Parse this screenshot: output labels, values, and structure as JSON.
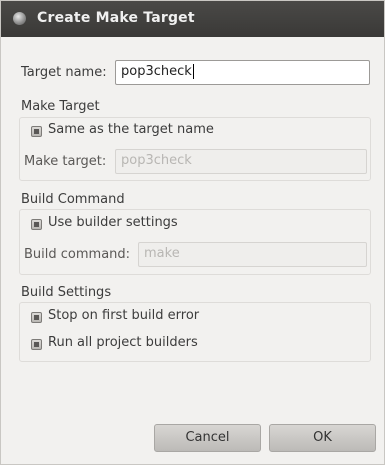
{
  "dialog": {
    "title": "Create Make Target"
  },
  "target": {
    "name_label": "Target name:",
    "name_value": "pop3check"
  },
  "make_target": {
    "section_label": "Make Target",
    "same_as_label": "Same as the target name",
    "same_as_checked": true,
    "field_label": "Make target:",
    "field_value": "pop3check"
  },
  "build_command": {
    "section_label": "Build Command",
    "use_builder_label": "Use builder settings",
    "use_builder_checked": true,
    "field_label": "Build command:",
    "field_value": "make"
  },
  "build_settings": {
    "section_label": "Build Settings",
    "stop_on_error_label": "Stop on first build error",
    "stop_on_error_checked": true,
    "run_all_label": "Run all project builders",
    "run_all_checked": true
  },
  "buttons": {
    "cancel": "Cancel",
    "ok": "OK"
  }
}
